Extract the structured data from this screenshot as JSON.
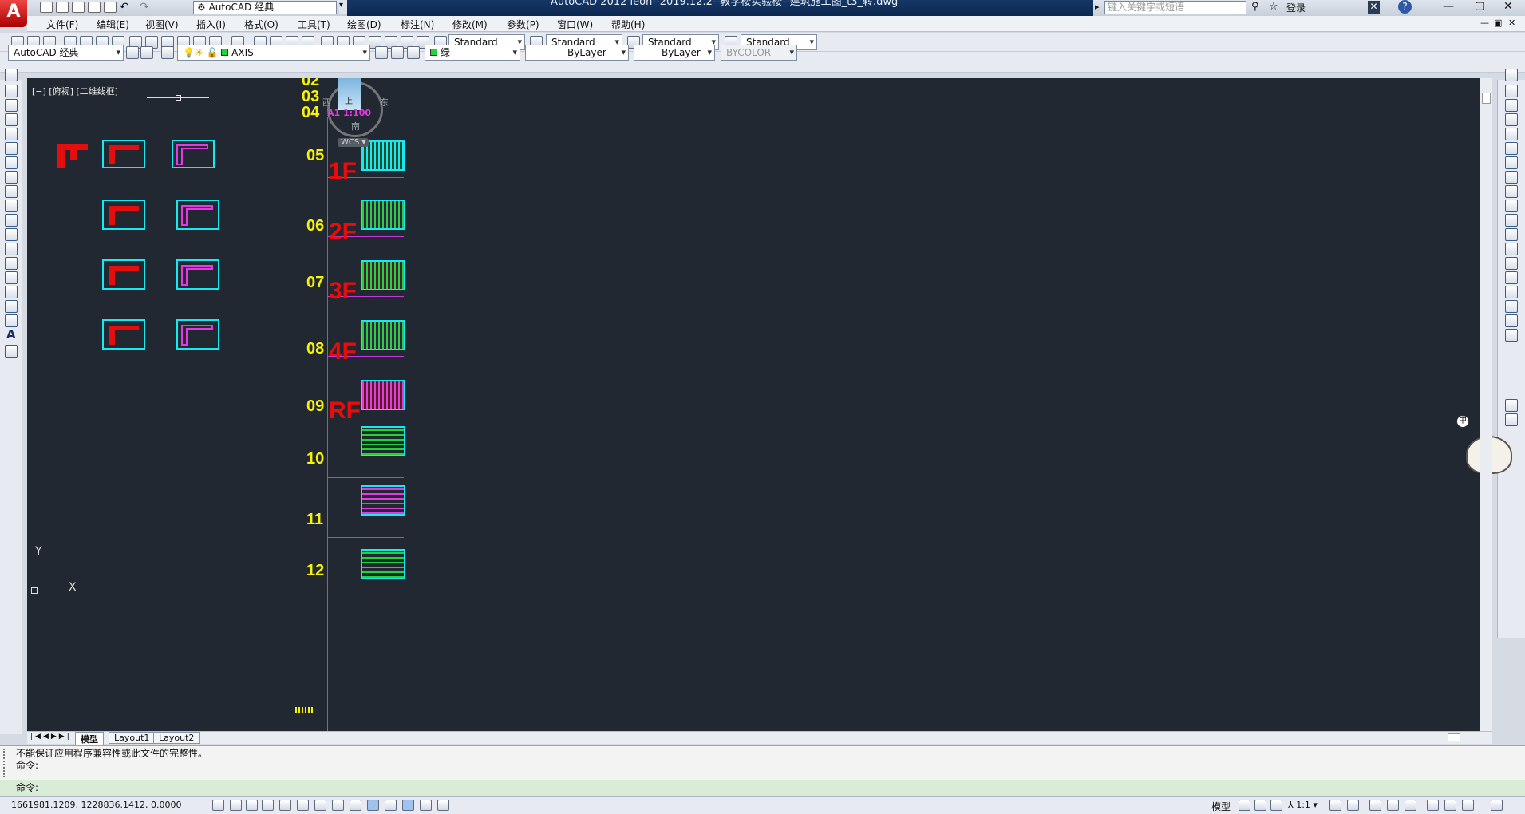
{
  "app": {
    "logo": "A",
    "workspace": "AutoCAD 经典",
    "title": "AutoCAD 2012     leon--2019.12.2--教学楼实验楼--建筑施工图_t3_转.dwg",
    "search_placeholder": "键入关键字或短语",
    "login": "登录"
  },
  "menu": [
    "文件(F)",
    "编辑(E)",
    "视图(V)",
    "插入(I)",
    "格式(O)",
    "工具(T)",
    "绘图(D)",
    "标注(N)",
    "修改(M)",
    "参数(P)",
    "窗口(W)",
    "帮助(H)"
  ],
  "styles": {
    "text_style": "Standard",
    "dim_style": "Standard",
    "table_style": "Standard",
    "mleader_style": "Standard"
  },
  "layers": {
    "workspace": "AutoCAD 经典",
    "current_layer": "AXIS",
    "color": "绿",
    "linetype": "ByLayer",
    "lineweight": "ByLayer",
    "plotstyle": "BYCOLOR"
  },
  "viewport": {
    "label": "[−] [俯视] [二维线框]",
    "viewcube": {
      "west": "西",
      "east": "东",
      "south": "南",
      "top": "上",
      "ucs": "WCS"
    },
    "scale_label": "A1 1:100"
  },
  "drawing": {
    "sheet_numbers": [
      "02",
      "03",
      "04",
      "05",
      "06",
      "07",
      "08",
      "09",
      "10",
      "11",
      "12"
    ],
    "floor_labels": [
      "1F",
      "2F",
      "3F",
      "4F",
      "RF"
    ],
    "axis_x": "X",
    "axis_y": "Y"
  },
  "layout_tabs": [
    "模型",
    "Layout1",
    "Layout2"
  ],
  "command": {
    "history": [
      "不能保证应用程序兼容性或此文件的完整性。",
      "命令:"
    ],
    "prompt": "命令:"
  },
  "status": {
    "coords": "1661981.1209, 1228836.1412, 0.0000",
    "model": "模型",
    "annotation_scale": "1:1"
  },
  "colors": {
    "canvas": "#222831",
    "yellow_text": "#f7f20a",
    "red_text": "#e80c0c",
    "cyan": "#18e8f0",
    "magenta": "#c43ad6",
    "title_bg": "#163a6b"
  }
}
